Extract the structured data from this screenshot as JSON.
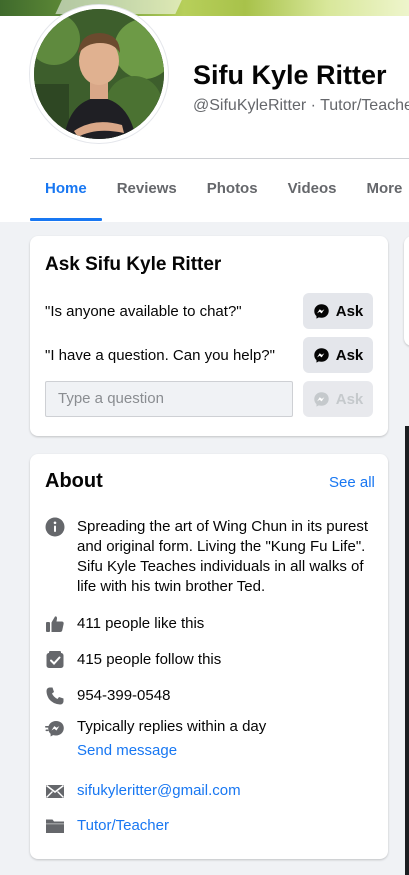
{
  "header": {
    "name": "Sifu Kyle Ritter",
    "subtitle": "@SifuKyleRitter · Tutor/Teacher"
  },
  "tabs": [
    {
      "label": "Home",
      "active": true
    },
    {
      "label": "Reviews",
      "active": false
    },
    {
      "label": "Photos",
      "active": false
    },
    {
      "label": "Videos",
      "active": false
    },
    {
      "label": "More",
      "active": false
    }
  ],
  "ask": {
    "title": "Ask Sifu Kyle Ritter",
    "questions": [
      "\"Is anyone available to chat?\"",
      "\"I have a question. Can you help?\""
    ],
    "ask_label": "Ask",
    "input_placeholder": "Type a question"
  },
  "about": {
    "title": "About",
    "see_all": "See all",
    "description": "Spreading the art of Wing Chun in its purest and original form. Living the \"Kung Fu Life\". Sifu Kyle Teaches individuals in all walks of life with his twin brother Ted.",
    "likes": "411 people like this",
    "follows": "415 people follow this",
    "phone": "954-399-0548",
    "reply_time": "Typically replies within a day",
    "send_message": "Send message",
    "email": "sifukyleritter@gmail.com",
    "category": "Tutor/Teacher"
  },
  "icons": {
    "info": "info-icon",
    "like": "thumbs-up-icon",
    "follow": "follow-check-icon",
    "phone": "phone-icon",
    "messenger": "messenger-icon",
    "email": "envelope-icon",
    "category": "folder-icon"
  },
  "colors": {
    "accent": "#1877f2",
    "icon_gray": "#65676b",
    "background": "#f0f2f5"
  }
}
